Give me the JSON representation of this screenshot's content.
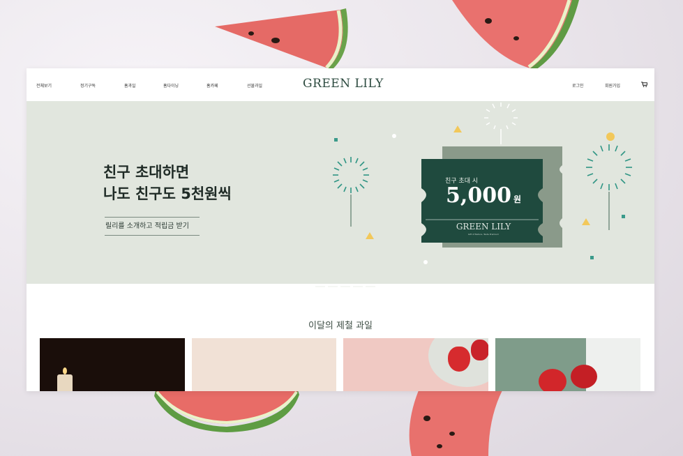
{
  "nav": {
    "left_items": [
      "전체보기",
      "정기구독",
      "홈과일",
      "홈다이닝",
      "홈카페",
      "선물과일"
    ],
    "logo": "GREEN LILY",
    "login": "로그인",
    "signup": "회원가입",
    "cart_icon": "cart-icon"
  },
  "hero": {
    "headline_line1": "친구 초대하면",
    "headline_line2": "나도 친구도 5천원씩",
    "cta_label": "릴리를 소개하고 적립금 받기",
    "ticket": {
      "caption": "친구 초대 시",
      "amount": "5,000",
      "unit": "원",
      "brand": "GREEN LILY",
      "tagline": "Gift of Nature, Taste Premium"
    },
    "slide_count": 6,
    "active_slide": 1
  },
  "section": {
    "title": "이달의 제철 과일"
  },
  "colors": {
    "brand_green": "#2d4b40",
    "ticket_green": "#1f4a3e",
    "ticket_back": "#8a9a8a",
    "hero_bg": "#e1e6de",
    "accent_teal": "#3a9a8a",
    "accent_yellow": "#f2c85a"
  }
}
